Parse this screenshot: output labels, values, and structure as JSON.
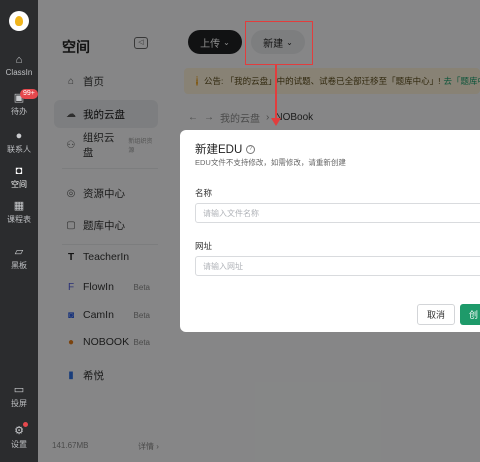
{
  "rail": {
    "items": [
      {
        "label": "ClassIn",
        "icon": "home-icon"
      },
      {
        "label": "待办",
        "icon": "todo-icon",
        "badge": "99+"
      },
      {
        "label": "联系人",
        "icon": "contacts-icon"
      },
      {
        "label": "空间",
        "icon": "cloud-space-icon",
        "active": true
      },
      {
        "label": "课程表",
        "icon": "calendar-icon"
      },
      {
        "label": "黑板",
        "icon": "blackboard-icon"
      },
      {
        "label": "投屏",
        "icon": "cast-icon"
      },
      {
        "label": "设置",
        "icon": "settings-icon"
      }
    ]
  },
  "sidebar": {
    "title": "空间",
    "items": [
      {
        "label": "首页",
        "icon": "home-icon"
      },
      {
        "label": "我的云盘",
        "icon": "cloud-icon",
        "active": true
      },
      {
        "label": "组织云盘",
        "icon": "group-icon",
        "note": "新组织资源"
      },
      {
        "label": "资源中心",
        "icon": "compass-icon"
      },
      {
        "label": "题库中心",
        "icon": "question-bank-icon"
      },
      {
        "label": "TeacherIn",
        "icon": "teacherin-icon"
      },
      {
        "label": "FlowIn",
        "icon": "flowin-icon",
        "tag": "Beta"
      },
      {
        "label": "CamIn",
        "icon": "camin-icon",
        "tag": "Beta"
      },
      {
        "label": "NOBOOK",
        "icon": "nobook-icon",
        "tag": "Beta"
      },
      {
        "label": "希悦",
        "icon": "xiyue-icon"
      }
    ],
    "storage": "141.67MB",
    "details": "详情 ›"
  },
  "toolbar": {
    "upload": "上传",
    "new": "新建"
  },
  "notice": {
    "text": "公告: 「我的云盘」中的试题、试卷已全部迁移至「题库中心」!",
    "link": "去「题库中心"
  },
  "breadcrumb": {
    "root": "我的云盘",
    "current": "NOBook"
  },
  "modal": {
    "title": "新建EDU",
    "subtitle": "EDU文件不支持修改，如需修改，请重新创建",
    "name_label": "名称",
    "name_placeholder": "请输入文件名称",
    "url_label": "网址",
    "url_placeholder": "请输入网址",
    "cancel": "取消",
    "create": "创"
  },
  "colors": {
    "accent": "#1e9a6a",
    "annotation": "#e23d3d",
    "rail": "#2b2c2e"
  }
}
